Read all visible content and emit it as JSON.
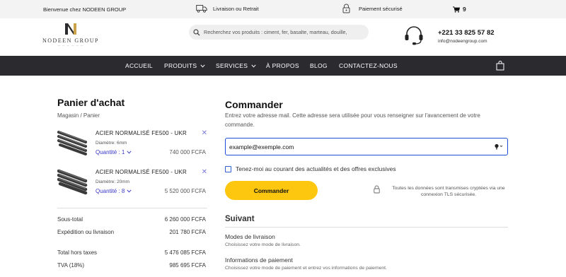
{
  "topbar": {
    "welcome": "Bienvenue chez NODEEN GROUP",
    "delivery": "Livraison ou Retrait",
    "secure": "Paiement sécurisé",
    "cart_count": "9"
  },
  "header": {
    "logo_name": "NODEEN GROUP",
    "search_placeholder": "Recherchez vos produits : ciment, fer, basalte, marteau, douille,",
    "phone": "+221 33 825 57 82",
    "email": "info@nodeengroup.com"
  },
  "nav": {
    "items": [
      "ACCUEIL",
      "PRODUITS",
      "SERVICES",
      "À PROPOS",
      "BLOG",
      "CONTACTEZ-NOUS"
    ]
  },
  "cart": {
    "title": "Panier d'achat",
    "breadcrumb": "Magasin  /  Panier",
    "products": [
      {
        "name": "ACIER NORMALISÉ FE500 - UKR",
        "diameter": "Diamètre: 6mm",
        "quantity": "Quantité : 1",
        "price": "740 000 FCFA"
      },
      {
        "name": "ACIER NORMALISÉ FE500 - UKR",
        "diameter": "Diamètre: 20mm",
        "quantity": "Quantité : 8",
        "price": "5 520 000 FCFA"
      }
    ],
    "totals": [
      {
        "label": "Sous-total",
        "value": "6 260 000 FCFA"
      },
      {
        "label": "Expédition ou livraison",
        "value": "201 780 FCFA"
      },
      {
        "label": "Total hors taxes",
        "value": "5 476 085 FCFA"
      },
      {
        "label": "TVA (18%)",
        "value": "985 695 FCFA"
      }
    ]
  },
  "checkout": {
    "title": "Commander",
    "intro": "Entrez votre adresse mail. Cette adresse sera utilisée pour vous renseigner sur l'avancement de votre commande.",
    "email_value": "example@exemple.com",
    "newsletter_label": "Tenez-moi au courant des actualités et des offres exclusives",
    "order_button": "Commander",
    "tls_note": "Toutes les données sont transmises cryptées via une connexion TLS sécurisée.",
    "next_title": "Suivant",
    "steps": [
      {
        "title": "Modes de livraison",
        "desc": "Choisissez votre mode de livraison."
      },
      {
        "title": "Informations de paiement",
        "desc": "Choisissez votre mode de paiement et entrez vos informations de paiement."
      }
    ]
  },
  "colors": {
    "nav_bg": "#2b2a2e",
    "button_yellow": "#fcc70e",
    "accent_blue": "#1d4fd6",
    "quantity_purple": "#3838c8"
  }
}
